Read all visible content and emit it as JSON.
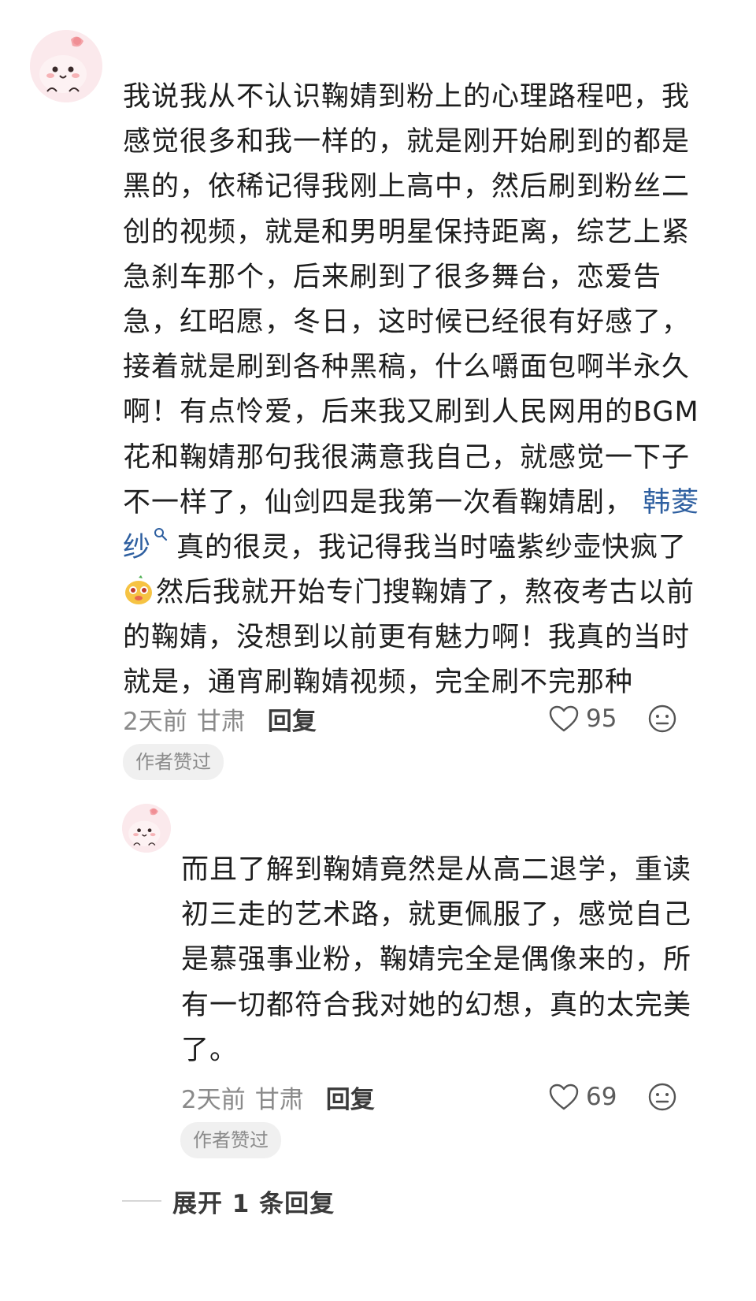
{
  "comment": {
    "lines": [
      "我说我从不认识鞠婧到粉上的心理路程吧，我",
      "感觉很多和我一样的，就是刚开始刷到的都是",
      "黑的，依稀记得我刚上高中，然后刷到粉丝二",
      "创的视频，就是和男明星保持距离，综艺上紧",
      "急刹车那个，后来刷到了很多舞台，恋爱告",
      "急，红昭愿，冬日，这时候已经很有好感了，",
      "接着就是刷到各种黑稿，什么嚼面包啊半永久",
      "啊！有点怜爱，后来我又刷到人民网用的BGM",
      "花和鞠婧那句我很满意我自己，就感觉一下子"
    ],
    "line10_text": "不一样了，仙剑四是我第一次看鞠婧剧，",
    "link_part1": "韩菱",
    "link_part2": "纱",
    "line11_rest": "真的很灵，我记得我当时嗑紫纱壶快疯了",
    "line12_rest": "然后我就开始专门搜鞠婧了，熬夜考古以前",
    "lines_tail": [
      "的鞠婧，没想到以前更有魅力啊！我真的当时",
      "就是，通宵刷鞠婧视频，完全刷不完那种"
    ],
    "time": "2天前",
    "location": "甘肃",
    "reply_label": "回复",
    "like_count": "95",
    "badge": "作者赞过"
  },
  "reply": {
    "lines": [
      "而且了解到鞠婧竟然是从高二退学，重读",
      "初三走的艺术路，就更佩服了，感觉自己",
      "是慕强事业粉，鞠婧完全是偶像来的，所",
      "有一切都符合我对她的幻想，真的太完美",
      "了。"
    ],
    "time": "2天前",
    "location": "甘肃",
    "reply_label": "回复",
    "like_count": "69",
    "badge": "作者赞过"
  },
  "expand": {
    "label": "展开 1 条回复"
  },
  "colors": {
    "link": "#2e5fa0",
    "avatar_bg": "#fbe9ec",
    "badge_bg": "#f0f0f0"
  }
}
